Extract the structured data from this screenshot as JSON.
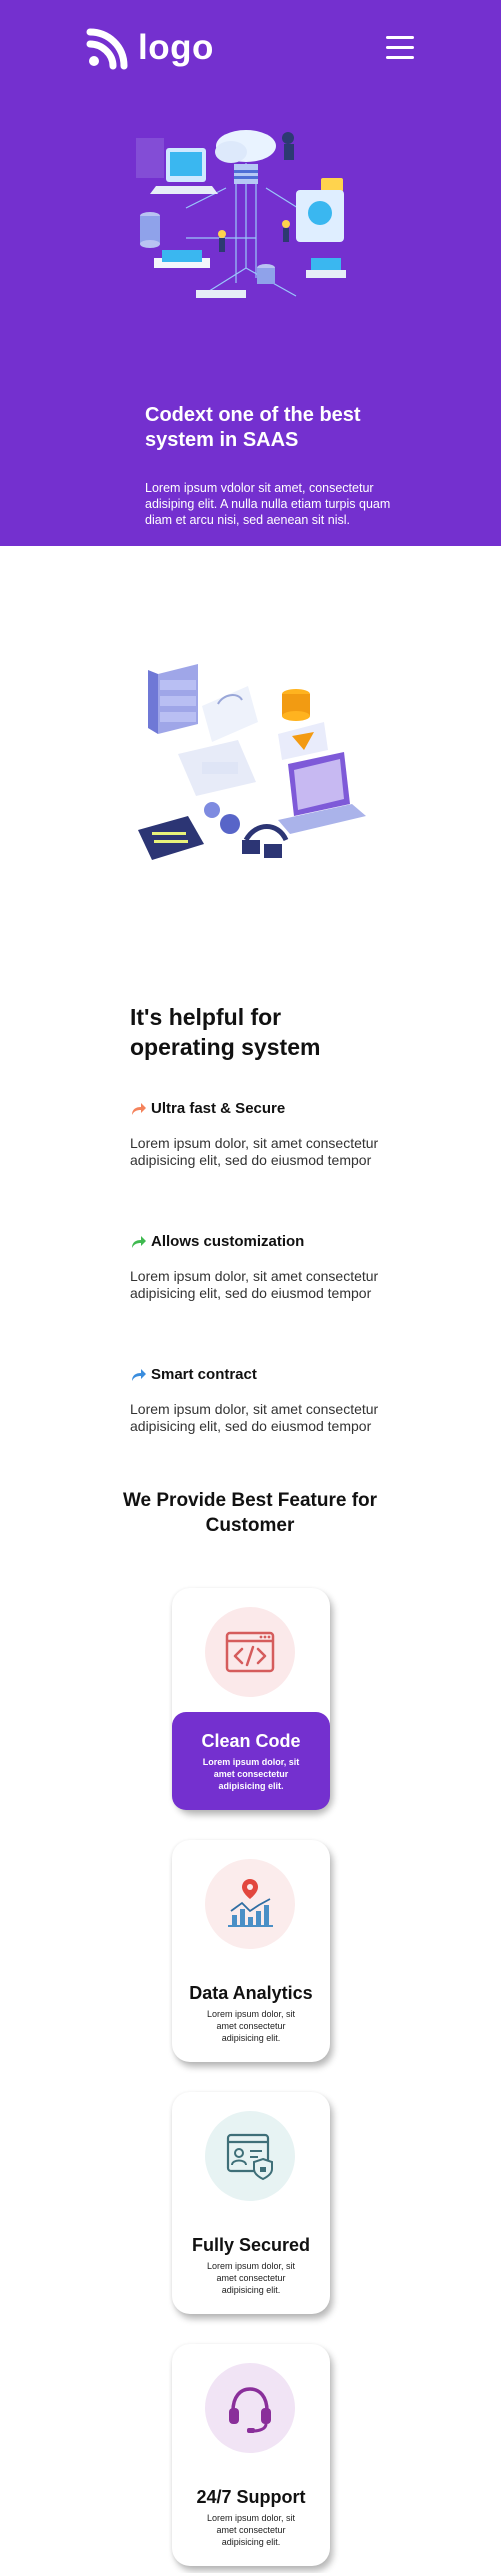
{
  "brand": {
    "logo_text": "logo",
    "primary_color": "#7430cf"
  },
  "hero": {
    "title": "Codext one of the best system in SAAS",
    "text": "Lorem ipsum vdolor sit amet, consectetur adisiping elit. A nulla nulla etiam turpis quam diam et arcu nisi, sed aenean sit nisl."
  },
  "helpful": {
    "title": "It's helpful for operating system",
    "features": [
      {
        "label": "Ultra fast & Secure",
        "arrow_color": "#f4825b",
        "text": "Lorem ipsum dolor, sit amet consectetur adipisicing elit, sed do eiusmod tempor"
      },
      {
        "label": "Allows customization",
        "arrow_color": "#3fb950",
        "text": "Lorem ipsum dolor, sit amet consectetur adipisicing elit, sed do eiusmod tempor"
      },
      {
        "label": "Smart contract",
        "arrow_color": "#3a8dde",
        "text": "Lorem ipsum dolor, sit amet consectetur adipisicing elit, sed do eiusmod tempor"
      }
    ]
  },
  "provide": {
    "title": "We Provide Best Feature for Customer",
    "cards": [
      {
        "title": "Clean Code",
        "text": "Lorem ipsum dolor, sit amet consectetur adipisicing elit.",
        "icon": "code-window-icon",
        "active": true
      },
      {
        "title": "Data Analytics",
        "text": "Lorem ipsum dolor, sit amet consectetur adipisicing elit.",
        "icon": "analytics-chart-icon",
        "active": false
      },
      {
        "title": "Fully Secured",
        "text": "Lorem ipsum dolor, sit amet consectetur adipisicing elit.",
        "icon": "secure-profile-icon",
        "active": false
      },
      {
        "title": "24/7 Support",
        "text": "Lorem ipsum dolor, sit amet consectetur adipisicing elit.",
        "icon": "headset-icon",
        "active": false
      }
    ]
  }
}
